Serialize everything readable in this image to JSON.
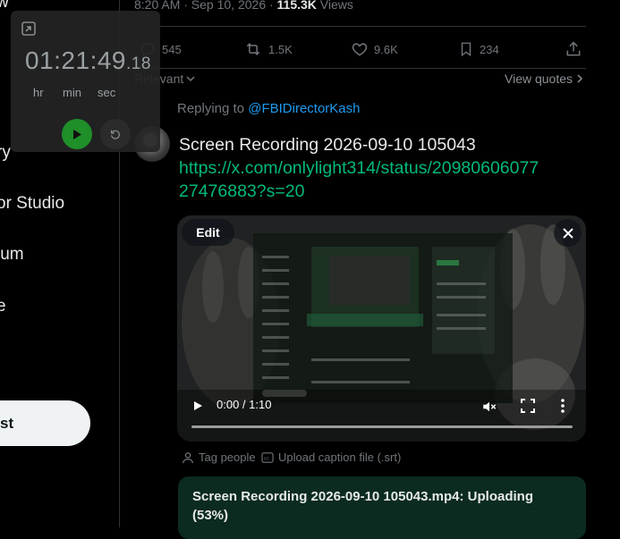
{
  "nav": {
    "items": [
      {
        "label": "ry"
      },
      {
        "label": "or Studio"
      },
      {
        "label": "ium"
      },
      {
        "label": "e"
      }
    ],
    "post_button": "st",
    "top_fragment": "w"
  },
  "stopwatch": {
    "time_main": "01:21:49",
    "time_ms": ".18",
    "units": [
      "hr",
      "min",
      "sec"
    ]
  },
  "tweet": {
    "time": "8:20 AM · Sep 10, 2026 · ",
    "views_count": "115.3K",
    "views_label": " Views",
    "actions": {
      "replies": "545",
      "reposts": "1.5K",
      "likes": "9.6K",
      "bookmarks": "234"
    },
    "sort_label": "Relevant",
    "view_quotes": "View quotes"
  },
  "reply": {
    "replying_to_label": "Replying to ",
    "replying_to_handle": "@FBIDirectorKash",
    "title": "Screen Recording 2026-09-10 105043",
    "link_line1": "https://x.com/onlylight314/status/20980606077",
    "link_line2": "27476883?s=20"
  },
  "video": {
    "edit_label": "Edit",
    "time": "0:00 / 1:10",
    "progress": 0
  },
  "media_tools": {
    "tag_people": "Tag people",
    "upload_caption": "Upload caption file (.srt)"
  },
  "upload": {
    "status": "Screen Recording 2026-09-10 105043.mp4: Uploading (53%)",
    "percent": 53
  }
}
